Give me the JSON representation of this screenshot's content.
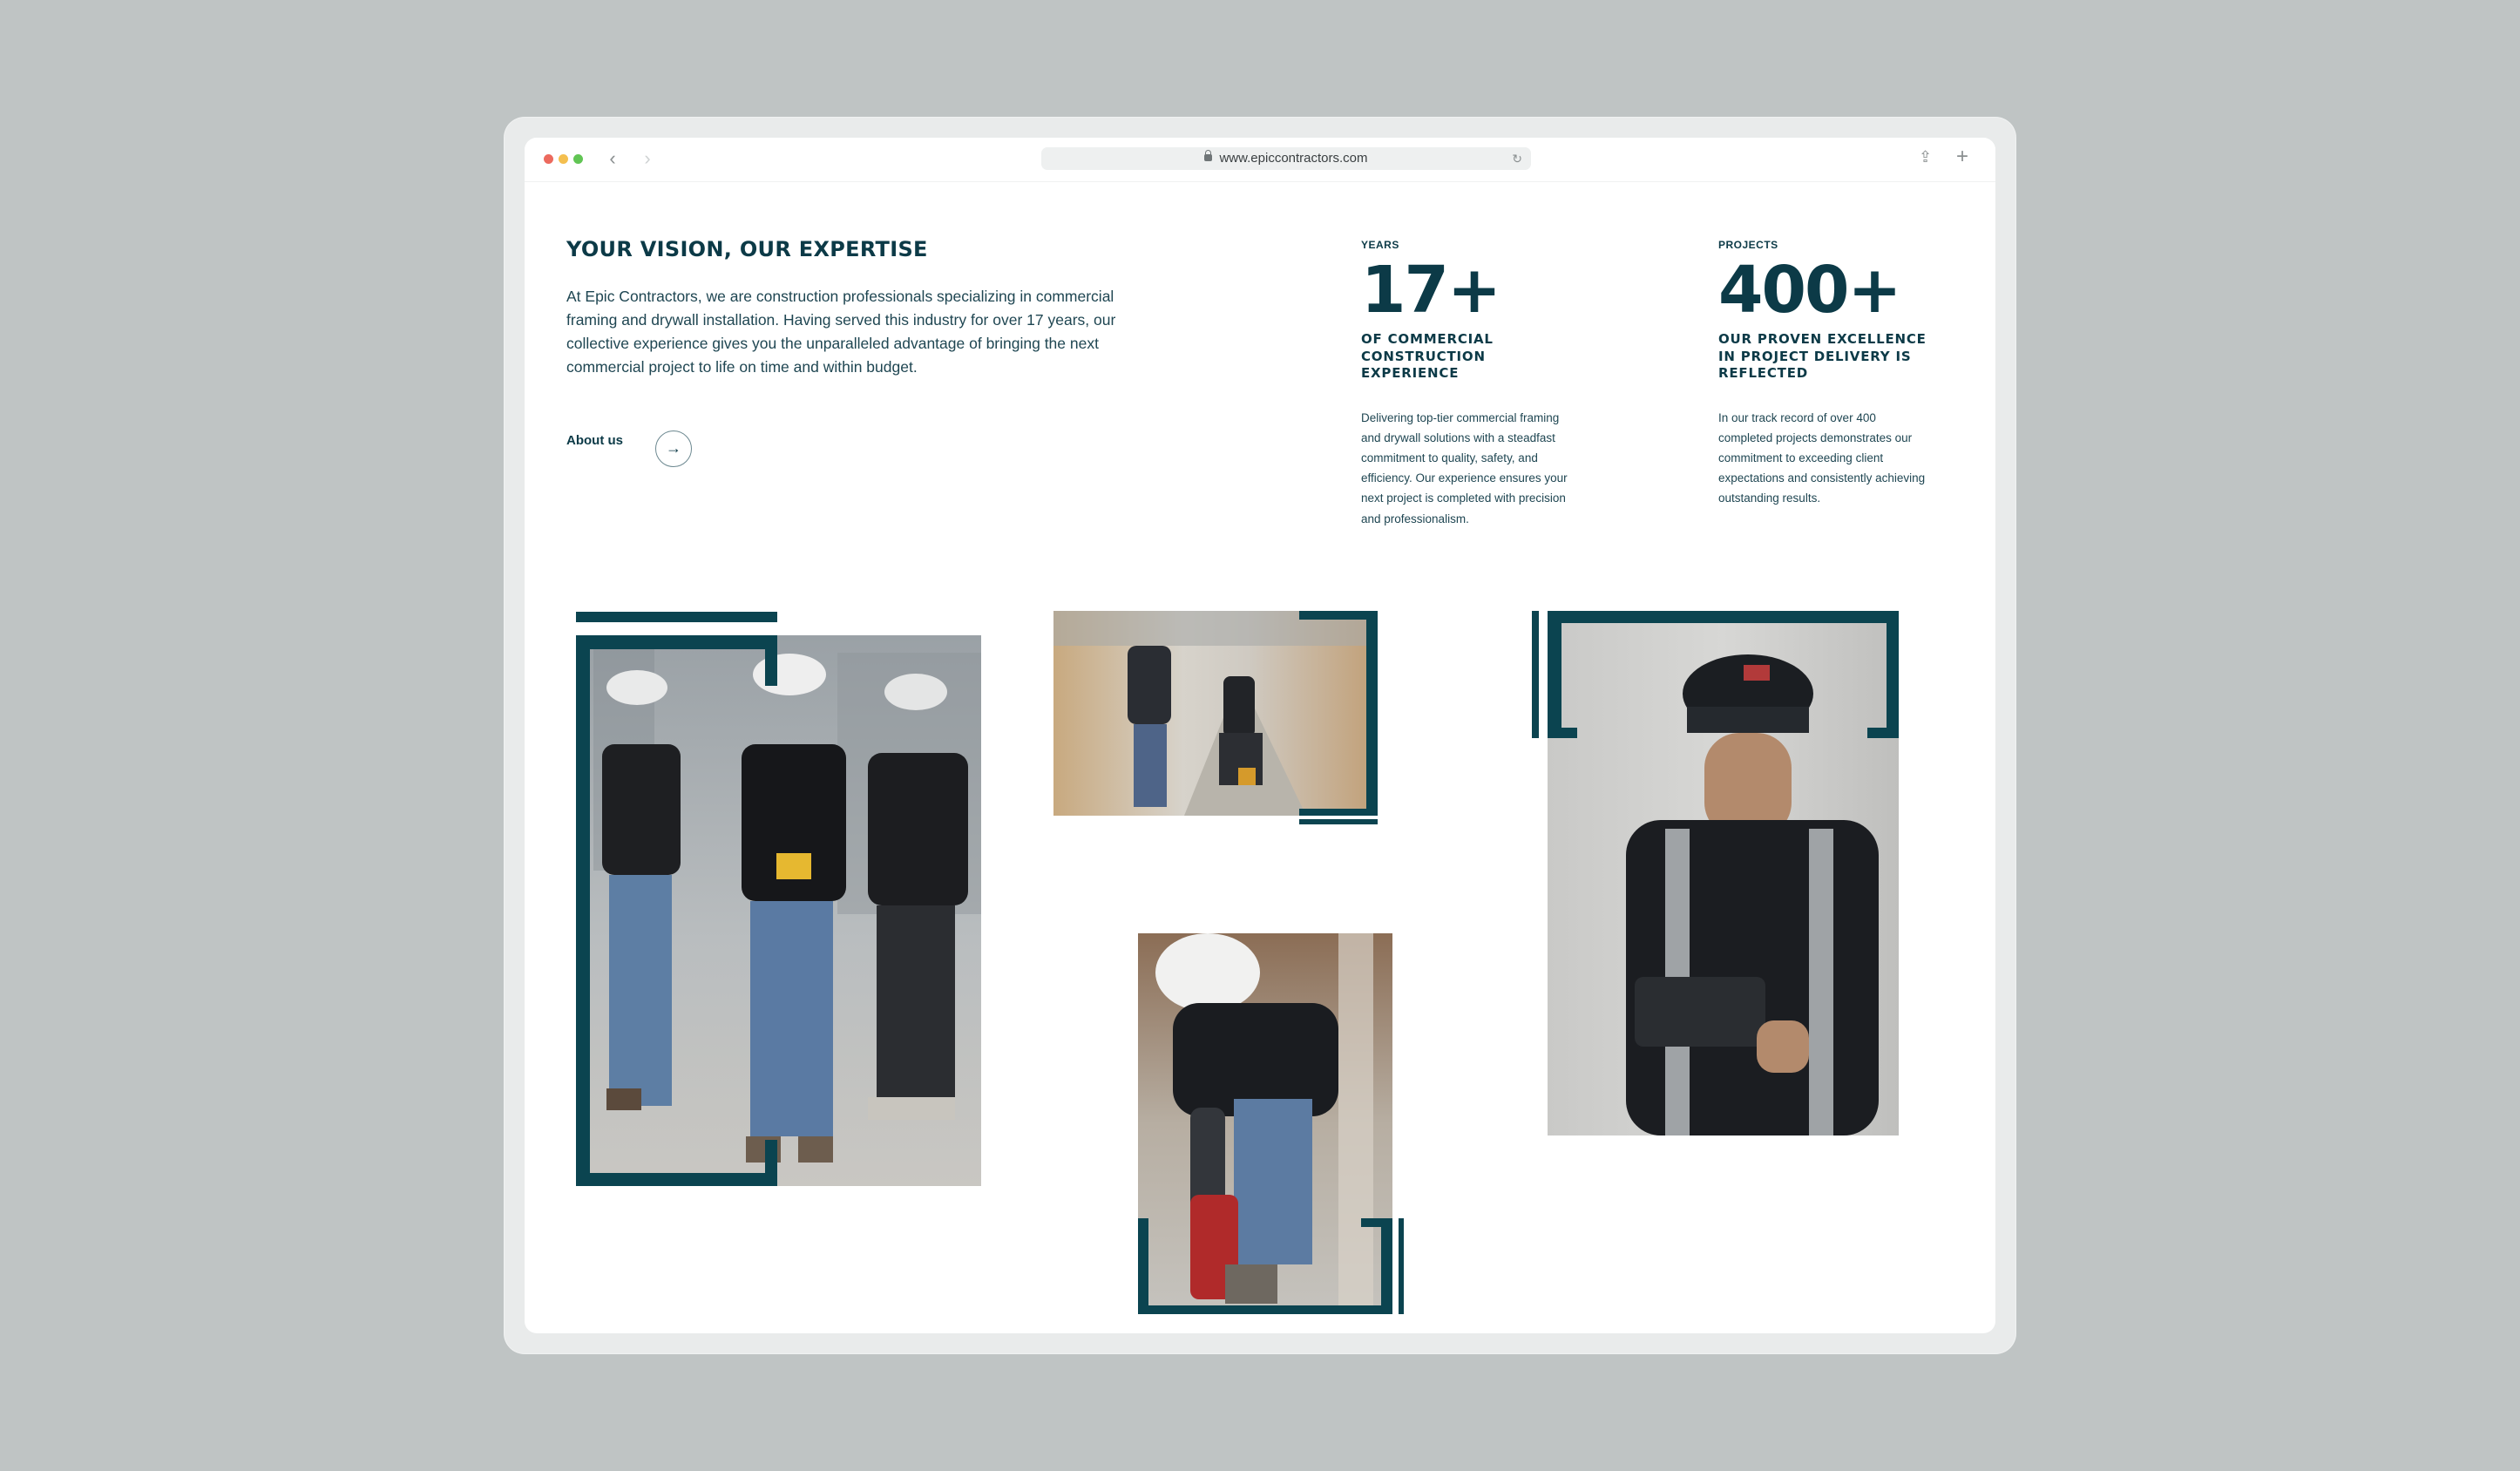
{
  "browser": {
    "url": "www.epiccontractors.com",
    "icons": [
      "close-dot",
      "minimize-dot",
      "zoom-dot",
      "back-icon",
      "forward-icon",
      "lock-icon",
      "reload-icon",
      "share-icon",
      "new-tab-icon"
    ]
  },
  "intro": {
    "heading": "YOUR VISION, OUR EXPERTISE",
    "body": "At Epic Contractors, we are construction professionals specializing in commercial framing and drywall installation. Having served this industry for over 17 years, our collective experience gives you the unparalleled advantage of bringing the next commercial project to life on time and within budget.",
    "about_label": "About us",
    "about_icon": "arrow-right-icon"
  },
  "stats": [
    {
      "label": "YEARS",
      "value": "17+",
      "caption": "OF COMMERCIAL CONSTRUCTION EXPERIENCE",
      "description": "Delivering top-tier commercial framing and drywall solutions with a steadfast commitment to quality, safety, and efficiency. Our experience ensures your next project is completed with precision and professionalism."
    },
    {
      "label": "PROJECTS",
      "value": "400+",
      "caption": "OUR PROVEN EXCELLENCE IN PROJECT DELIVERY IS REFLECTED",
      "description": "In our track record of over 400 completed projects demonstrates our commitment to exceeding client expectations and consistently achieving outstanding results."
    }
  ],
  "gallery": {
    "accent_color": "#0b4450",
    "photos": [
      "three-workers-photo",
      "drywall-hallway-photo",
      "worker-drilling-photo",
      "worker-tablet-photo"
    ]
  }
}
